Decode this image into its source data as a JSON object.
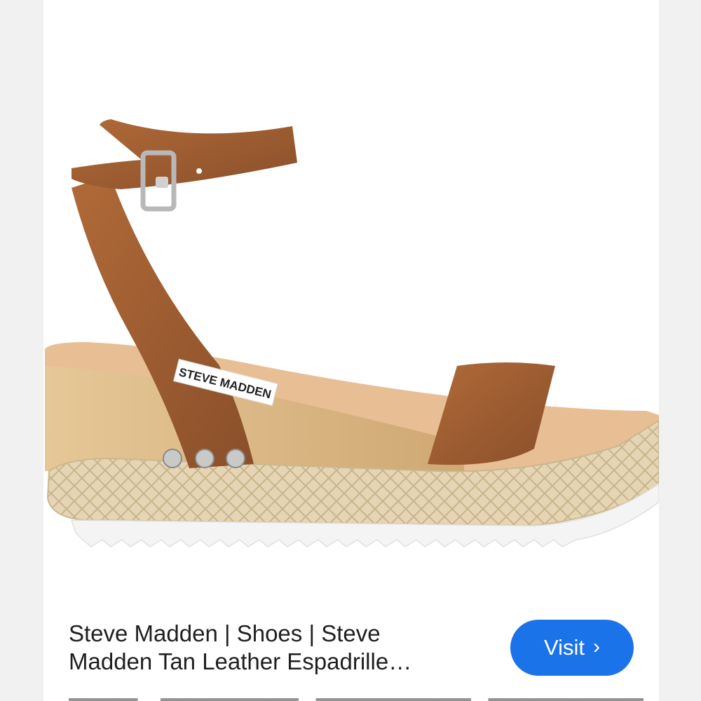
{
  "product": {
    "title": "Steve Madden | Shoes | Steve Madden Tan Leather Espadrille…",
    "image_label": "STEVE MADDEN",
    "image_alt": "Tan leather ankle-strap espadrille wedge sandal"
  },
  "actions": {
    "visit_label": "Visit",
    "visit_icon": "chevron-right-icon"
  },
  "colors": {
    "accent": "#1a73e8",
    "leather": "#9a5a30",
    "wood": "#d9b886",
    "jute": "#e2d1ae"
  }
}
